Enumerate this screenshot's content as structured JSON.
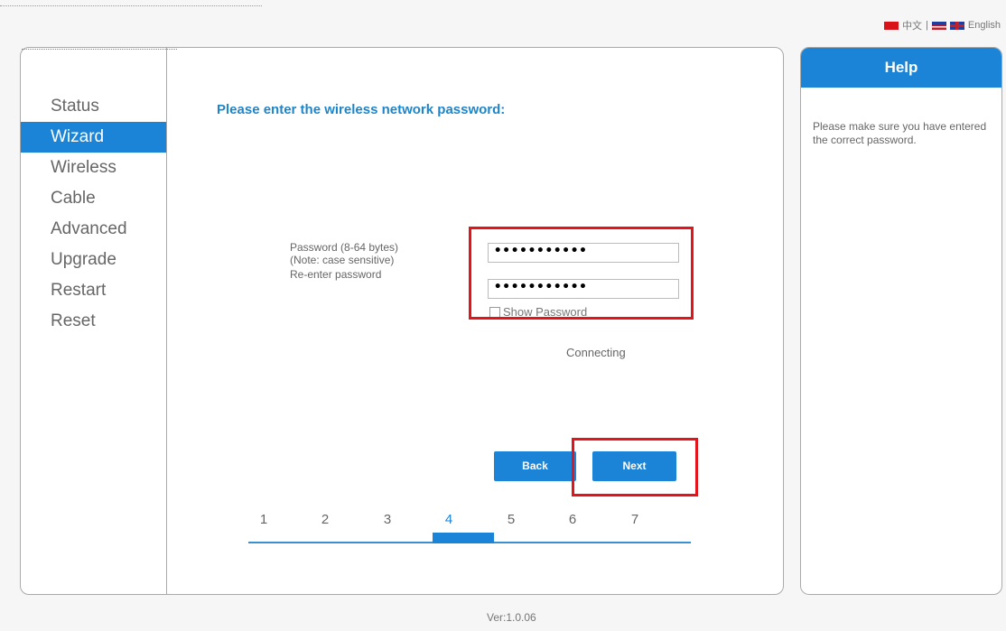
{
  "language_bar": {
    "chinese": "中文",
    "separator": "|",
    "english": "English"
  },
  "sidebar": {
    "items": [
      {
        "label": "Status",
        "active": false
      },
      {
        "label": "Wizard",
        "active": true
      },
      {
        "label": "Wireless",
        "active": false
      },
      {
        "label": "Cable",
        "active": false
      },
      {
        "label": "Advanced",
        "active": false
      },
      {
        "label": "Upgrade",
        "active": false
      },
      {
        "label": "Restart",
        "active": false
      },
      {
        "label": "Reset",
        "active": false
      }
    ]
  },
  "main": {
    "heading": "Please enter the wireless network password:",
    "password_label": "Password (8-64 bytes)",
    "password_note": "(Note: case sensitive)",
    "reenter_label": "Re-enter password",
    "password_value": "•••••••••••",
    "reenter_value": "•••••••••••",
    "show_password_label": "Show Password",
    "status_text": "Connecting",
    "back_label": "Back",
    "next_label": "Next",
    "steps": [
      "1",
      "2",
      "3",
      "4",
      "5",
      "6",
      "7"
    ],
    "current_step": "4"
  },
  "help": {
    "title": "Help",
    "text": "Please make sure you have entered the correct password."
  },
  "footer": {
    "version": "Ver:1.0.06"
  },
  "colors": {
    "accent": "#1b84d6",
    "heading": "#1d85c9",
    "highlight": "#e3141c"
  }
}
